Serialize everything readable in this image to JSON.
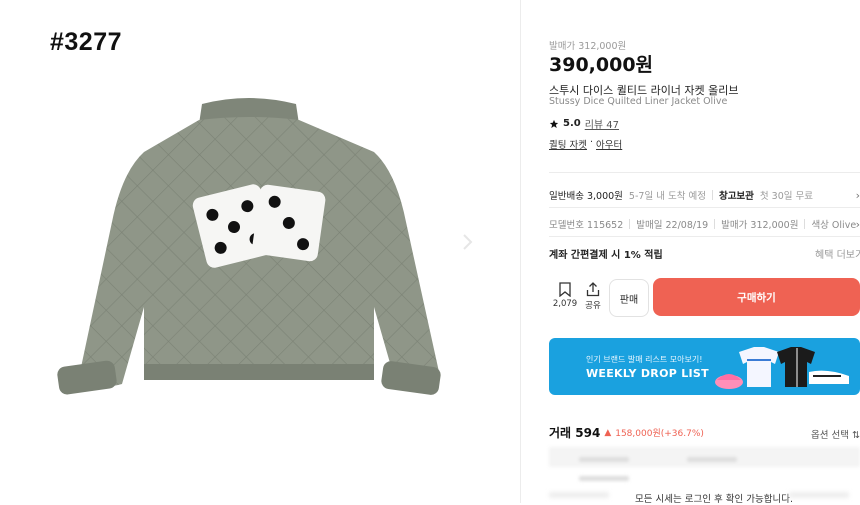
{
  "overlay_tag": "#3277",
  "product": {
    "release_price_label": "발매가 312,000원",
    "price": "390,000원",
    "name_ko": "스투시 다이스 퀼티드 라이너 자켓 올리브",
    "name_en": "Stussy Dice Quilted Liner Jacket Olive",
    "rating": "5.0",
    "review_label": "리뷰 47",
    "categories": [
      "퀼팅 자켓",
      "아우터"
    ],
    "category_sep": "·"
  },
  "shipping": {
    "label": "일반배송 3,000원",
    "eta": "5-7일 내 도착 예정",
    "storage_label": "창고보관",
    "storage_value": "첫 30일 무료"
  },
  "info": {
    "model": "모델번호 115652",
    "release_date": "발매일 22/08/19",
    "release_price": "발매가 312,000원",
    "color": "색상 Olive"
  },
  "benefit": {
    "text": "계좌 간편결제 시 1% 적립",
    "more": "혜택 더보기"
  },
  "actions": {
    "wish_count": "2,079",
    "share_label": "공유",
    "sell_label": "판매",
    "buy_label": "구매하기"
  },
  "banner": {
    "subtitle": "인기 브랜드 발매 리스트 모아보기!",
    "title": "WEEKLY DROP LIST"
  },
  "trade": {
    "label": "거래 594",
    "change": "158,000원(+36.7%)",
    "option_select": "옵션 선택"
  },
  "login_note": "모든 시세는 로그인 후 확인 가능합니다.",
  "colors": {
    "buy": "#ef6253",
    "banner": "#1aa1df",
    "jacket": "#8f9688"
  },
  "icons": [
    "star-icon",
    "bookmark-icon",
    "share-icon",
    "chevron-right-icon",
    "sort-icon"
  ]
}
